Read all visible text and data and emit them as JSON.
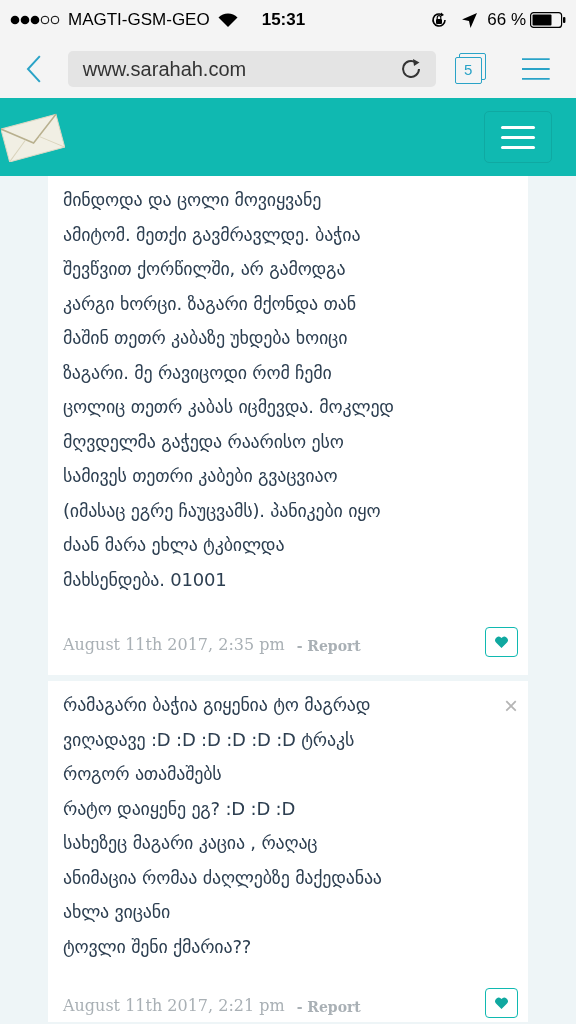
{
  "status_bar": {
    "carrier": "MAGTI-GSM-GEO",
    "time": "15:31",
    "battery": "66 %"
  },
  "browser": {
    "url": "www.sarahah.com",
    "tab_count": "5"
  },
  "messages": [
    {
      "lines": [
        "მინდოდა და ცოლი მოვიყვანე",
        "ამიტომ. მეთქი გავმრავლდე. ბაჭია",
        "შევწვით ქორწილში, არ გამოდგა",
        "კარგი ხორცი. ზაგარი მქონდა თან",
        "მაშინ თეთრ კაბაზე უხდება ხოიცი",
        "ზაგარი. მე რავიცოდი რომ ჩემი",
        "ცოლიც თეთრ კაბას იცმევდა. მოკლედ",
        "მღვდელმა გაჭედა რაარისო ესო",
        "სამივეს თეთრი კაბები გვაცვიაო",
        "(იმასაც ეგრე ჩაუცვამს). პანიკები იყო",
        "ძაან მარა ეხლა ტკბილდა",
        "მახსენდება. 01001"
      ],
      "date": "August 11th 2017, 2:35 pm",
      "report": "- Report"
    },
    {
      "lines": [
        "რამაგარი ბაჭია გიყენია ტო მაგრად",
        "ვიღადავე :D :D :D :D :D :D ტრაკს",
        "როგორ ათამაშებს",
        "რატო დაიყენე ეგ? :D :D :D",
        "სახეზეც მაგარი კაცია , რაღაც",
        "ანიმაცია რომაა ძაღლებზე მაქედანაა",
        "ახლა ვიცანი",
        "ტოვლი შენი ქმარია??"
      ],
      "date": "August 11th 2017, 2:21 pm",
      "report": "- Report",
      "close_label": "×"
    }
  ]
}
